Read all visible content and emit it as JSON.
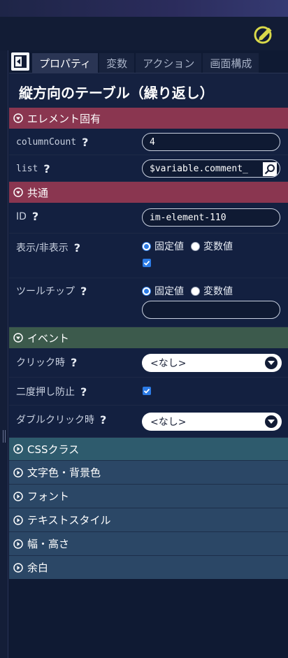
{
  "tabs": [
    {
      "label": "プロパティ",
      "active": true
    },
    {
      "label": "変数"
    },
    {
      "label": "アクション"
    },
    {
      "label": "画面構成"
    }
  ],
  "title": "縦方向のテーブル（繰り返し）",
  "sections": {
    "element": {
      "label": "エレメント固有",
      "columnCount": {
        "label": "columnCount",
        "value": "4"
      },
      "list": {
        "label": "list",
        "value": "$variable.comment_"
      }
    },
    "common": {
      "label": "共通",
      "id": {
        "label": "ID",
        "value": "im-element-110"
      },
      "visibility": {
        "label": "表示/非表示",
        "fixed": "固定値",
        "variable": "変数値"
      },
      "tooltip": {
        "label": "ツールチップ",
        "fixed": "固定値",
        "variable": "変数値",
        "value": ""
      }
    },
    "event": {
      "label": "イベント",
      "click": {
        "label": "クリック時",
        "value": "<なし>"
      },
      "double_submit": {
        "label": "二度押し防止"
      },
      "dblclick": {
        "label": "ダブルクリック時",
        "value": "<なし>"
      }
    },
    "css_class": "CSSクラス",
    "color": "文字色・背景色",
    "font": "フォント",
    "text_style": "テキストスタイル",
    "size": "幅・高さ",
    "margin": "余白"
  },
  "help_mark": "?",
  "colors": {
    "accent": "#2c7be5",
    "edit_icon": "#d9d94a",
    "section_red": "#8a3650",
    "section_green": "#3c5a4c"
  },
  "icons": [
    "edit-icon",
    "collapse-panel-icon",
    "expand-circle-icon",
    "search-icon",
    "dropdown-arrow-icon",
    "check-icon"
  ]
}
